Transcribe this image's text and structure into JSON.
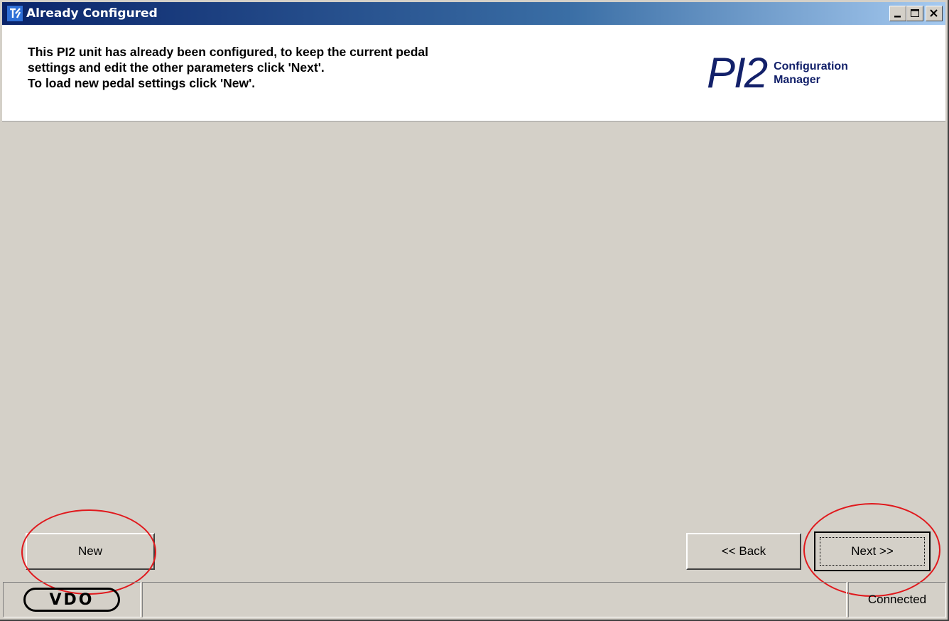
{
  "window": {
    "title": "Already Configured"
  },
  "header": {
    "instruction_lines": [
      "This PI2 unit has already been configured, to keep the current pedal",
      "settings and edit the other parameters click 'Next'.",
      "To load new pedal settings click 'New'."
    ],
    "logo_main": "PI2",
    "logo_sub_line1": "Configuration",
    "logo_sub_line2": "Manager"
  },
  "buttons": {
    "new_label": "New",
    "back_label": "<< Back",
    "next_label": "Next >>"
  },
  "statusbar": {
    "brand": "VDO",
    "status": "Connected"
  },
  "icons": {
    "app": "pi2-app-icon",
    "minimize": "minimize-icon",
    "maximize": "maximize-icon",
    "close": "close-icon"
  },
  "colors": {
    "title_bar_start": "#0a246a",
    "title_bar_end": "#a6caf0",
    "logo": "#13216a",
    "highlight": "#e0191d",
    "face": "#d4d0c8"
  }
}
